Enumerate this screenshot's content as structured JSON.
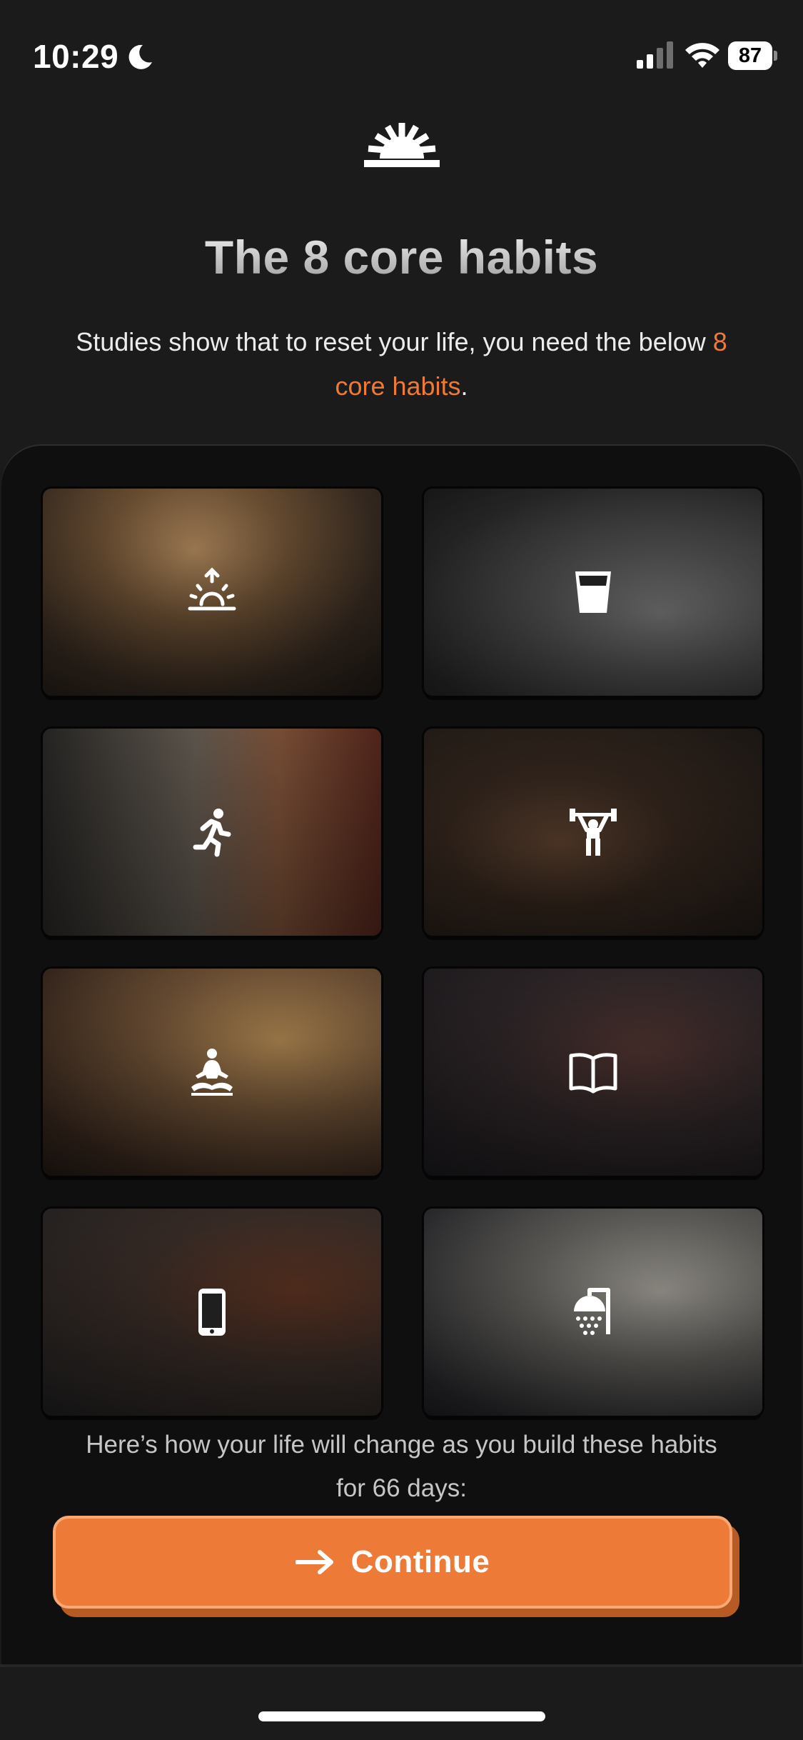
{
  "status_bar": {
    "time": "10:29",
    "battery": "87",
    "icons": [
      "moon-icon",
      "signal-icon",
      "wifi-icon",
      "battery-icon"
    ]
  },
  "header": {
    "logo_icon": "sunrise-logo-icon",
    "title": "The 8 core habits",
    "subtitle_prefix": "Studies show that to reset your life, you need the below ",
    "subtitle_accent": "8 core habits",
    "subtitle_suffix": ".",
    "accent_color": "#ee7a37"
  },
  "habits": [
    {
      "icon": "sunrise-icon"
    },
    {
      "icon": "water-glass-icon"
    },
    {
      "icon": "running-icon"
    },
    {
      "icon": "weightlifting-icon"
    },
    {
      "icon": "meditation-icon"
    },
    {
      "icon": "book-icon"
    },
    {
      "icon": "phone-icon"
    },
    {
      "icon": "cold-shower-icon"
    }
  ],
  "footer": {
    "description": "Here’s how your life will change as you build these habits for 66 days:",
    "continue_label": "Continue",
    "continue_icon": "arrow-right-icon",
    "button_color": "#ee7a37"
  }
}
